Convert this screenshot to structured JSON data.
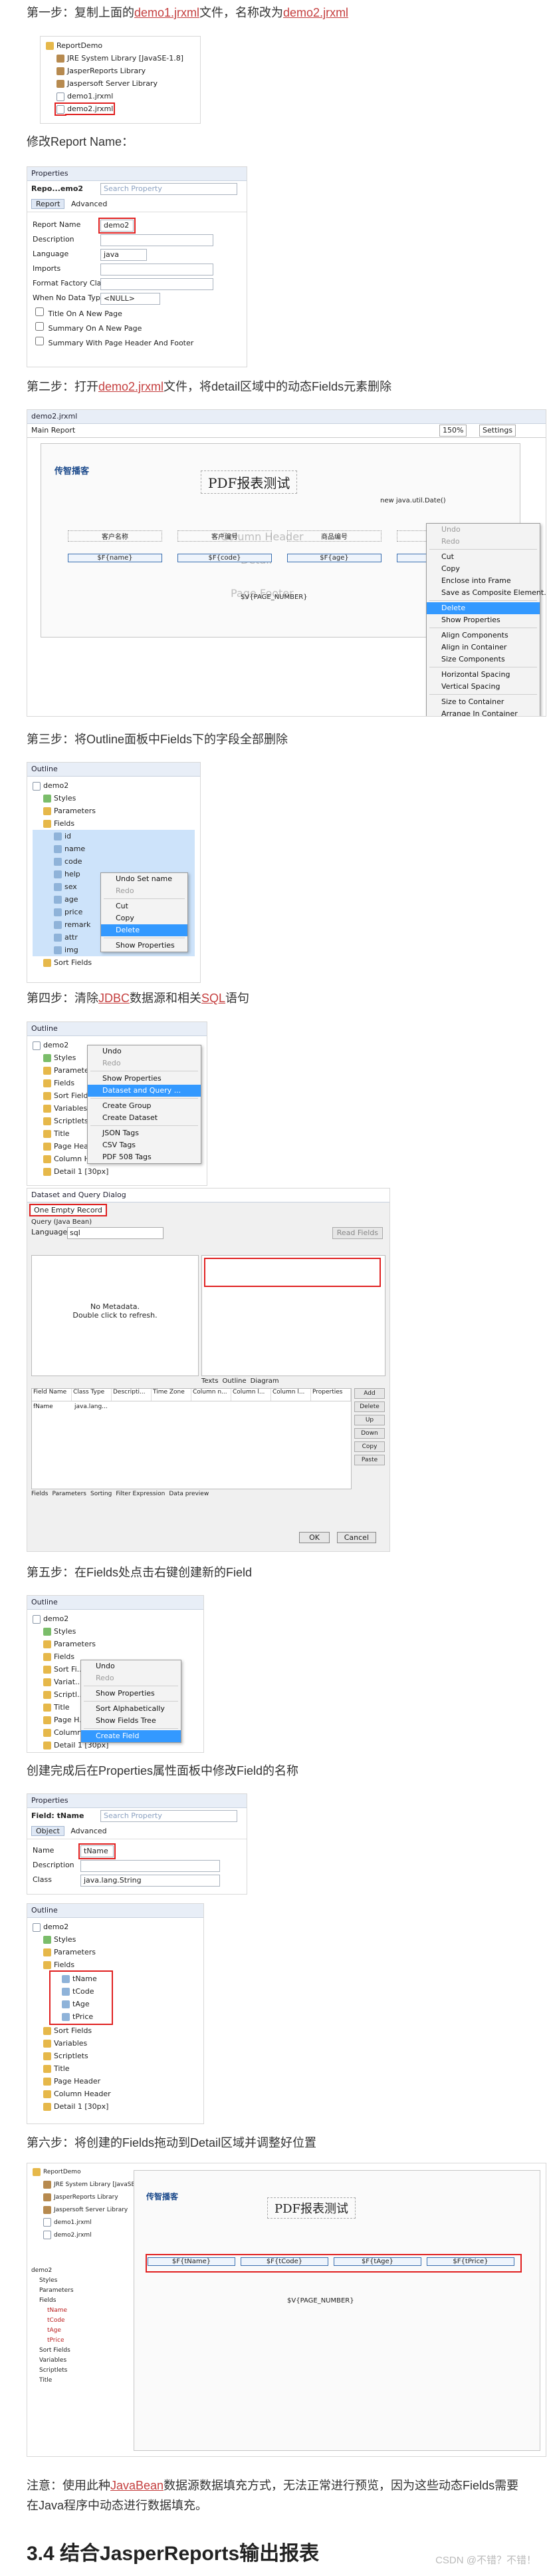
{
  "steps": {
    "s1": {
      "pre": "第一步：复制上面的",
      "link1": "demo1.jrxml",
      "mid": "文件，名称改为",
      "link2": "demo2.jrxml"
    },
    "s1b": "修改Report Name：",
    "s2": {
      "pre": "第二步：打开",
      "link": "demo2.jrxml",
      "post": "文件，将detail区域中的动态Fields元素删除"
    },
    "s3": "第三步：将Outline面板中Fields下的字段全部删除",
    "s4": {
      "pre": "第四步：清除",
      "link1": "JDBC",
      "mid": "数据源和相关",
      "link2": "SQL",
      "post": "语句"
    },
    "s5": "第五步：在Fields处点击右键创建新的Field",
    "s5b": "创建完成后在Properties属性面板中修改Field的名称",
    "s6": "第六步：将创建的Fields拖动到Detail区域并调整好位置"
  },
  "project_tree": {
    "root": "ReportDemo",
    "items": [
      "JRE System Library [JavaSE-1.8]",
      "JasperReports Library",
      "Jaspersoft Server Library",
      "demo1.jrxml",
      "demo2.jrxml"
    ]
  },
  "props1": {
    "title": "Properties",
    "report": "Repo...emo2",
    "search": "Search Property",
    "tabs": [
      "Report",
      "Advanced"
    ],
    "rows": [
      {
        "label": "Report Name",
        "value": "demo2"
      },
      {
        "label": "Description",
        "value": ""
      },
      {
        "label": "Language",
        "value": "java"
      },
      {
        "label": "Imports",
        "value": ""
      },
      {
        "label": "Format Factory Class",
        "value": ""
      },
      {
        "label": "When No Data Type",
        "value": "<NULL>"
      }
    ],
    "checks": [
      "Title On A New Page",
      "Summary On A New Page",
      "Summary With Page Header And Footer"
    ]
  },
  "designer": {
    "tab": "demo2.jrxml",
    "subtab": "Main Report",
    "zoom": "150%",
    "settings": "Settings",
    "title": "PDF报表测试",
    "logo": "传智播客",
    "date_expr": "new java.util.Date()",
    "headers": [
      "客户名称",
      "客户编号",
      "商品编号",
      "客户地址"
    ],
    "fields": [
      "$F{name}",
      "$F{code}",
      "$F{age}",
      "$F{pri...}"
    ],
    "column_header": "Column Header",
    "detail": "Detail",
    "footer": "Page Footer",
    "page_expr": "$V{PAGE_NUMBER}",
    "menu": [
      "Undo",
      "Redo",
      "Cut",
      "Copy",
      "Enclose into Frame",
      "Save as Composite Element...",
      "Delete",
      "Show Properties",
      "Align Components",
      "Align in Container",
      "Size Components",
      "Horizontal Spacing",
      "Vertical Spacing",
      "Size to Container",
      "Arrange In Container"
    ]
  },
  "outline1": {
    "title": "Outline",
    "root": "demo2",
    "items": [
      "Styles",
      "Parameters",
      "Fields"
    ],
    "fields": [
      "id",
      "name",
      "code",
      "help",
      "sex",
      "age",
      "price",
      "remark",
      "attr",
      "img"
    ],
    "after": "Sort Fields",
    "menu": [
      "Undo Set name",
      "Redo",
      "Cut",
      "Copy",
      "Delete",
      "Show Properties"
    ]
  },
  "outline2": {
    "title": "Outline",
    "root": "demo2",
    "menu": [
      "Undo",
      "Redo",
      "Show Properties",
      "Dataset and Query ...",
      "Create Group",
      "Create Dataset",
      "JSON Tags",
      "CSV Tags",
      "PDF 508 Tags"
    ],
    "items": [
      "Styles",
      "Parameters",
      "Fields",
      "Sort Fields",
      "Variables",
      "Scriptlets",
      "Title",
      "Page Header",
      "Column Header",
      "Detail 1 [30px]"
    ]
  },
  "dialog": {
    "title": "Dataset and Query Dialog",
    "adapter": "One Empty Record",
    "query_tab": "Query (Java Bean)",
    "language_label": "Language",
    "language": "sql",
    "read_fields": "Read Fields",
    "no_meta": "No Metadata.",
    "dbl": "Double click to refresh.",
    "tabs": [
      "Texts",
      "Outline",
      "Diagram"
    ],
    "cols": [
      "Field Name",
      "Class Type",
      "Descripti...",
      "Time Zone",
      "Column n...",
      "Column l...",
      "Column l...",
      "Properties"
    ],
    "rows": [
      [
        "fName",
        "java.lang..."
      ]
    ],
    "side_buttons": [
      "Add",
      "Delete",
      "Up",
      "Down",
      "Copy",
      "Paste"
    ],
    "bottom_tabs": [
      "Fields",
      "Parameters",
      "Sorting",
      "Filter Expression",
      "Data preview"
    ],
    "ok": "OK",
    "cancel": "Cancel"
  },
  "outline3": {
    "title": "Outline",
    "root": "demo2",
    "items": [
      "Styles",
      "Parameters",
      "Fields",
      "Sort Fi...",
      "Variat...",
      "Scriptl...",
      "Title",
      "Page H...",
      "Column...",
      "Detail 1 [30px]"
    ],
    "menu": [
      "Undo",
      "Redo",
      "Show Properties",
      "Sort Alphabetically",
      "Show Fields Tree",
      "Create Field"
    ]
  },
  "props2": {
    "title": "Properties",
    "field": "Field: tName",
    "search": "Search Property",
    "tabs": [
      "Object",
      "Advanced"
    ],
    "rows": [
      {
        "label": "Name",
        "value": "tName"
      },
      {
        "label": "Description",
        "value": ""
      },
      {
        "label": "Class",
        "value": "java.lang.String"
      }
    ]
  },
  "outline4": {
    "title": "Outline",
    "root": "demo2",
    "before": [
      "Styles",
      "Parameters",
      "Fields"
    ],
    "fields": [
      "tName",
      "tCode",
      "tAge",
      "tPrice"
    ],
    "after": [
      "Sort Fields",
      "Variables",
      "Scriptlets",
      "Title",
      "Page Header",
      "Column Header",
      "Detail 1 [30px]"
    ]
  },
  "final": {
    "tree_root": "ReportDemo",
    "tree_items": [
      "JRE System Library [JavaSE-1.8]",
      "JasperReports Library",
      "Jaspersoft Server Library",
      "demo1.jrxml",
      "demo2.jrxml"
    ],
    "outline_items": [
      "demo2",
      "Styles",
      "Parameters",
      "Fields",
      "tName",
      "tCode",
      "tAge",
      "tPrice",
      "Sort Fields",
      "Variables",
      "Scriptlets",
      "Title"
    ],
    "title": "PDF报表测试",
    "fields": [
      "$F{tName}",
      "$F{tCode}",
      "$F{tAge}",
      "$F{tPrice}"
    ],
    "detail": "Detail 1",
    "page_expr": "$V{PAGE_NUMBER}"
  },
  "note": {
    "pre": "注意：使用此种",
    "link": "JavaBean",
    "post": "数据源数据填充方式，无法正常进行预览，因为这些动态Fields需要在Java程序中动态进行数据填充。"
  },
  "section": "3.4 结合JasperReports输出报表",
  "watermark": "CSDN @不错？不错！"
}
